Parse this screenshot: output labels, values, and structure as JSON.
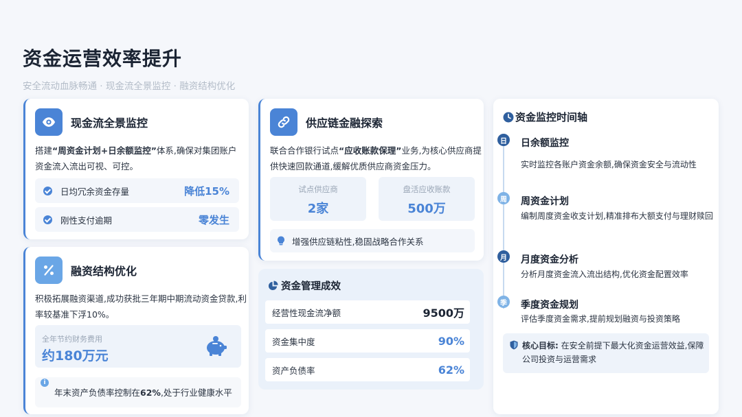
{
  "page": {
    "title": "资金运营效率提升",
    "subtitle": "安全流动血脉畅通 · 现金流全景监控 · 融资结构优化"
  },
  "cashflow": {
    "icon": "eye-icon",
    "title": "现金流全景监控",
    "desc_prefix": "搭建",
    "desc_highlight": "“周资金计划+日余额监控”",
    "desc_suffix": "体系,确保对集团账户资金流入流出可视、可控。",
    "stats": [
      {
        "label": "日均冗余资金存量",
        "value": "降低15%"
      },
      {
        "label": "刚性支付逾期",
        "value": "零发生"
      }
    ]
  },
  "financing": {
    "icon": "percent-icon",
    "title": "融资结构优化",
    "desc": "积极拓展融资渠道,成功获批三年期中期流动资金贷款,利率较基准下浮10%。",
    "saving_label": "全年节约财务费用",
    "saving_value": "约180万元",
    "saving_icon": "piggy-bank-icon",
    "note_prefix": "年末资产负债率控制在",
    "note_highlight": "62%",
    "note_suffix": ",处于行业健康水平"
  },
  "supply": {
    "icon": "link-icon",
    "title": "供应链金融探索",
    "desc_prefix": "联合合作银行试点",
    "desc_highlight": "“应收账款保理”",
    "desc_suffix": "业务,为核心供应商提供快速回款通道,缓解优质供应商资金压力。",
    "kpis": [
      {
        "label": "试点供应商",
        "value": "2家"
      },
      {
        "label": "盘活应收账款",
        "value": "500万"
      }
    ],
    "tip_icon": "lightbulb-icon",
    "tip": "增强供应链粘性,稳固战略合作关系"
  },
  "management": {
    "icon": "pie-chart-icon",
    "title": "资金管理成效",
    "rows": [
      {
        "label": "经营性现金流净额",
        "value": "9500万",
        "color": "#1b2433"
      },
      {
        "label": "资金集中度",
        "value": "90%",
        "color": "#4a84d6"
      },
      {
        "label": "资产负债率",
        "value": "62%",
        "color": "#4a84d6"
      }
    ]
  },
  "timeline": {
    "icon": "clock-icon",
    "title": "资金监控时间轴",
    "items": [
      {
        "badge": "日",
        "title": "日余额监控",
        "desc": "实时监控各账户资金余额,确保资金安全与流动性",
        "color": "#2f5f9e"
      },
      {
        "badge": "周",
        "title": "周资金计划",
        "desc": "编制周度资金收支计划,精准排布大额支付与理财赎回",
        "color": "#7fb3e6"
      },
      {
        "badge": "月",
        "title": "月度资金分析",
        "desc": "分析月度资金流入流出结构,优化资金配置效率",
        "color": "#2f5f9e"
      },
      {
        "badge": "季",
        "title": "季度资金规划",
        "desc": "评估季度资金需求,提前规划融资与投资策略",
        "color": "#7fb3e6"
      }
    ],
    "goal_icon": "shield-icon",
    "goal_label": "核心目标:",
    "goal_text": "在安全前提下最大化资金运营效益,保障公司投资与运营需求"
  }
}
